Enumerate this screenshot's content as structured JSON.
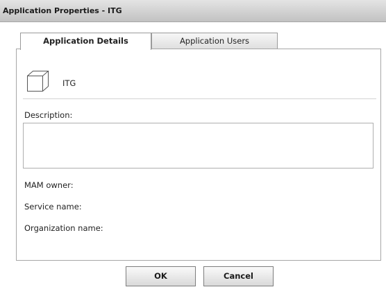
{
  "window": {
    "title": "Application Properties - ITG"
  },
  "tabs": [
    {
      "label": "Application Details",
      "active": true
    },
    {
      "label": "Application Users",
      "active": false
    }
  ],
  "app": {
    "name": "ITG",
    "icon": "cube-icon"
  },
  "fields": {
    "description_label": "Description:",
    "description_value": "",
    "mam_owner_label": "MAM owner:",
    "service_name_label": "Service name:",
    "organization_name_label": "Organization name:"
  },
  "buttons": {
    "ok": "OK",
    "cancel": "Cancel"
  }
}
